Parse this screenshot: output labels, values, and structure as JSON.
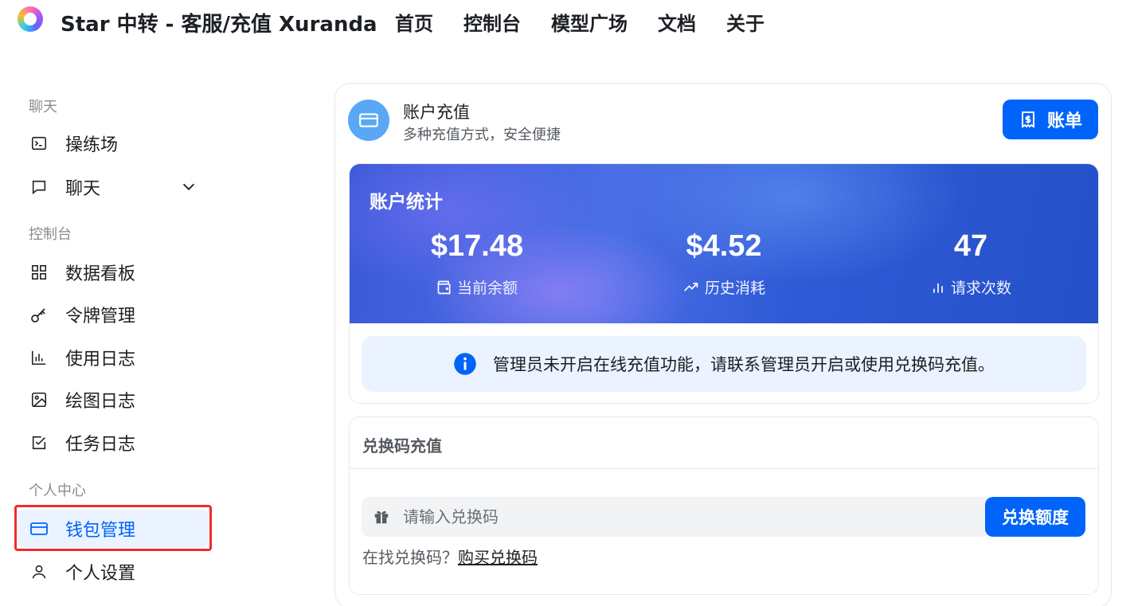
{
  "header": {
    "site_title": "Star 中转 - 客服/充值 Xuranda",
    "nav": [
      "首页",
      "控制台",
      "模型广场",
      "文档",
      "关于"
    ]
  },
  "sidebar": {
    "sections": [
      "聊天",
      "控制台",
      "个人中心"
    ],
    "items": [
      {
        "label": "操练场",
        "icon": "terminal-icon"
      },
      {
        "label": "聊天",
        "icon": "chat-bubble-icon"
      },
      {
        "label": "数据看板",
        "icon": "dashboard-grid-icon"
      },
      {
        "label": "令牌管理",
        "icon": "key-icon"
      },
      {
        "label": "使用日志",
        "icon": "bar-chart-icon"
      },
      {
        "label": "绘图日志",
        "icon": "image-icon"
      },
      {
        "label": "任务日志",
        "icon": "checkbox-icon"
      },
      {
        "label": "钱包管理",
        "icon": "credit-card-icon",
        "active": true
      },
      {
        "label": "个人设置",
        "icon": "user-icon"
      }
    ]
  },
  "main": {
    "title": "账户充值",
    "subtitle": "多种充值方式，安全便捷",
    "bill_button": "账单",
    "stats_title": "账户统计",
    "stats": [
      {
        "value": "$17.48",
        "label": "当前余额",
        "icon": "wallet-icon"
      },
      {
        "value": "$4.52",
        "label": "历史消耗",
        "icon": "trend-up-icon"
      },
      {
        "value": "47",
        "label": "请求次数",
        "icon": "bar-chart-icon"
      }
    ],
    "notice": "管理员未开启在线充值功能，请联系管理员开启或使用兑换码充值。",
    "redeem": {
      "title": "兑换码充值",
      "placeholder": "请输入兑换码",
      "button": "兑换额度",
      "hint": "在找兑换码？",
      "link": "购买兑换码"
    }
  },
  "colors": {
    "accent": "#0064fa",
    "active_bg": "#eaf3ff",
    "highlight_box": "#f02b2b",
    "banner": "#3a59d8"
  }
}
